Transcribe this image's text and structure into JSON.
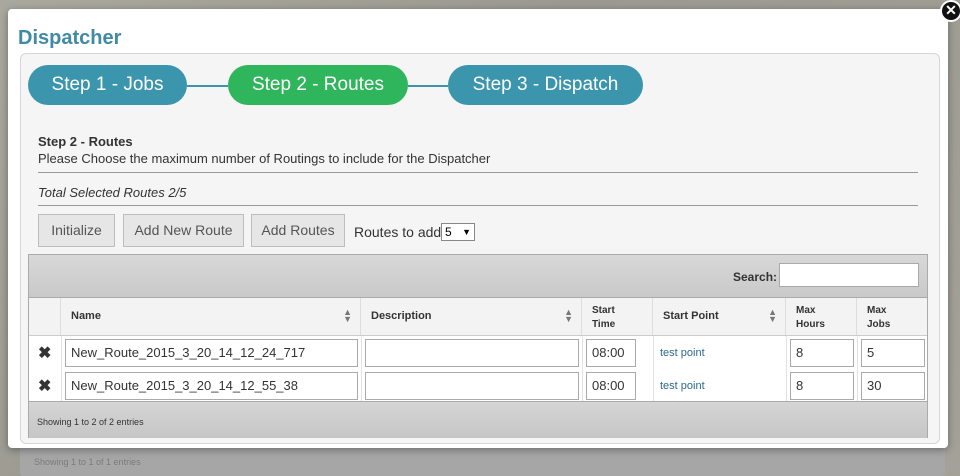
{
  "backdrop": {
    "footer_text": "Showing 1 to 1 of 1 entries"
  },
  "dialog": {
    "title": "Dispatcher",
    "close_glyph": "✕"
  },
  "steps": [
    {
      "label": "Step 1 - Jobs",
      "color": "#3a95ad"
    },
    {
      "label": "Step 2 - Routes",
      "color": "#2fb55b",
      "active": true
    },
    {
      "label": "Step 3 - Dispatch",
      "color": "#3a95ad"
    }
  ],
  "section": {
    "title": "Step 2 - Routes",
    "description": "Please Choose the maximum number of Routings to include for the Dispatcher",
    "total": "Total Selected Routes 2/5"
  },
  "toolbar": {
    "initialize": "Initialize",
    "add_new_route": "Add New Route",
    "add_routes": "Add Routes",
    "routes_to_add_label": "Routes to add",
    "routes_to_add_value": "5"
  },
  "grid": {
    "search_label": "Search:",
    "search_value": "",
    "columns": {
      "name": "Name",
      "description": "Description",
      "start_time": "Start Time",
      "start_point": "Start Point",
      "max_hours": "Max Hours",
      "max_jobs": "Max Jobs"
    },
    "rows": [
      {
        "name": "New_Route_2015_3_20_14_12_24_717",
        "description": "",
        "start_time": "08:00",
        "start_point": "test point",
        "max_hours": "8",
        "max_jobs": "5"
      },
      {
        "name": "New_Route_2015_3_20_14_12_55_38",
        "description": "",
        "start_time": "08:00",
        "start_point": "test point",
        "max_hours": "8",
        "max_jobs": "30"
      }
    ],
    "footer": "Showing 1 to 2 of 2 entries"
  },
  "icons": {
    "delete": "delete-icon",
    "close": "close-icon",
    "sort": "sort-icon"
  },
  "colors": {
    "title": "#3f8aa5",
    "step_inactive": "#3a95ad",
    "step_active": "#2fb55b",
    "link": "#2a6a8d"
  }
}
